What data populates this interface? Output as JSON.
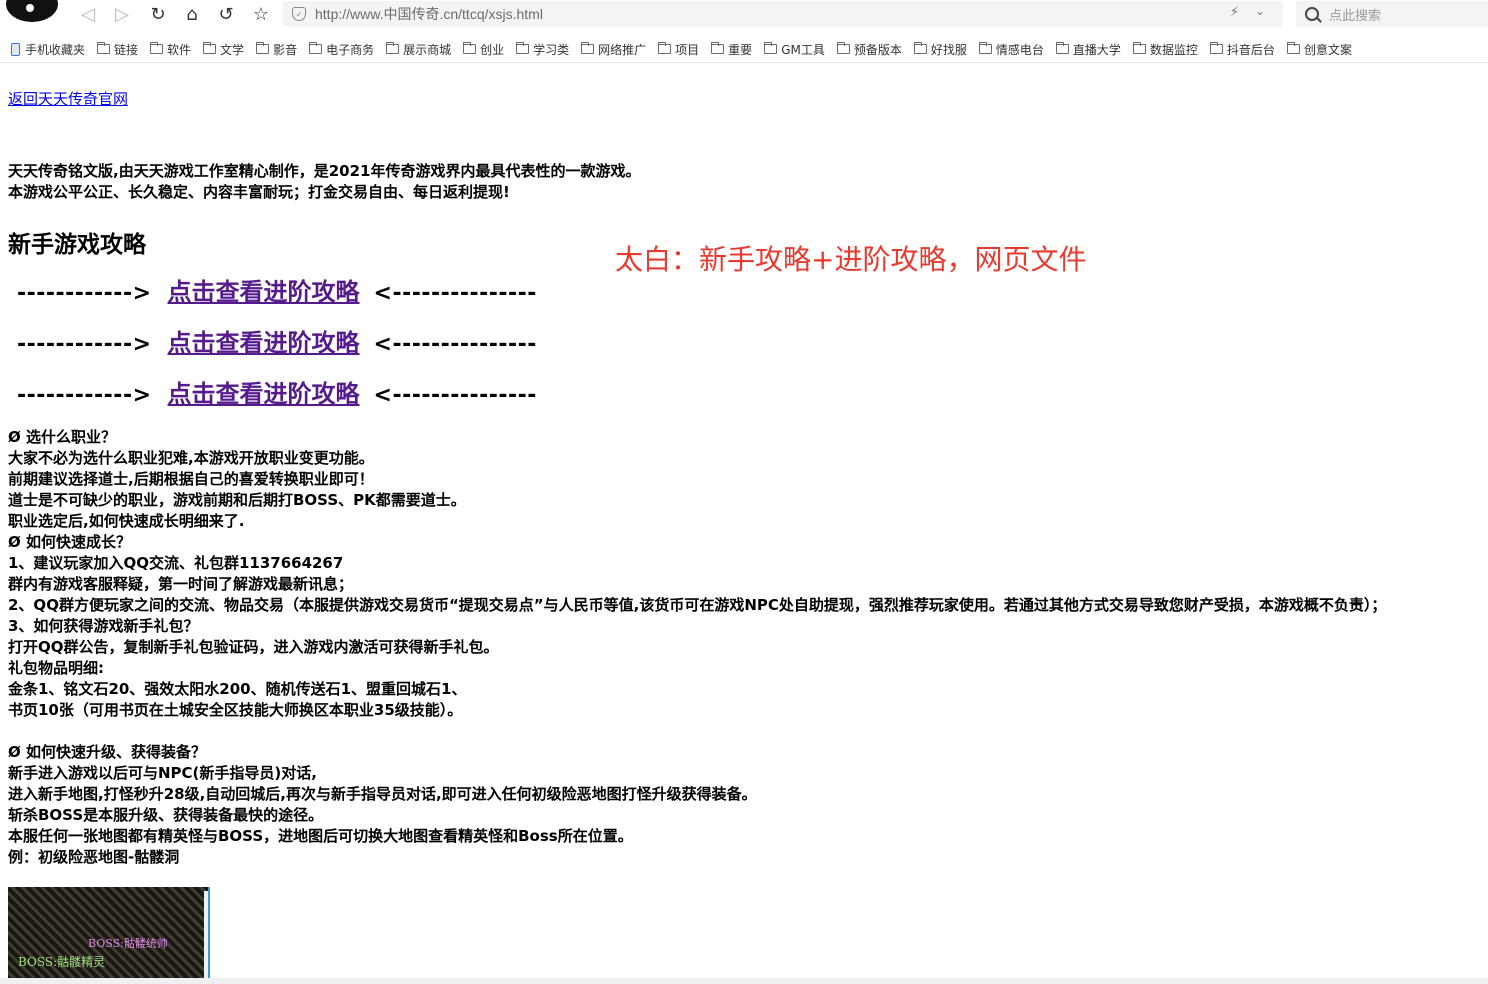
{
  "browser": {
    "url": "http://www.中国传奇.cn/ttcq/xsjs.html",
    "search_placeholder": "点此搜索",
    "icons": {
      "back": "◁",
      "forward": "▷",
      "reload": "↻",
      "home": "⌂",
      "undo": "↺",
      "star": "☆",
      "bolt": "⚡",
      "chevron": "⌄"
    }
  },
  "bookmarks": [
    {
      "label": "手机收藏夹",
      "icon": "phone"
    },
    {
      "label": "链接",
      "icon": "folder"
    },
    {
      "label": "软件",
      "icon": "folder"
    },
    {
      "label": "文学",
      "icon": "folder"
    },
    {
      "label": "影音",
      "icon": "folder"
    },
    {
      "label": "电子商务",
      "icon": "folder"
    },
    {
      "label": "展示商城",
      "icon": "folder"
    },
    {
      "label": "创业",
      "icon": "folder"
    },
    {
      "label": "学习类",
      "icon": "folder"
    },
    {
      "label": "网络推广",
      "icon": "folder"
    },
    {
      "label": "项目",
      "icon": "folder"
    },
    {
      "label": "重要",
      "icon": "folder"
    },
    {
      "label": "GM工具",
      "icon": "folder"
    },
    {
      "label": "预备版本",
      "icon": "folder"
    },
    {
      "label": "好找服",
      "icon": "folder"
    },
    {
      "label": "情感电台",
      "icon": "folder"
    },
    {
      "label": "直播大学",
      "icon": "folder"
    },
    {
      "label": "数据监控",
      "icon": "folder"
    },
    {
      "label": "抖音后台",
      "icon": "folder"
    },
    {
      "label": "创意文案",
      "icon": "folder"
    }
  ],
  "page": {
    "back_link": "返回天天传奇官网",
    "intro": [
      "天天传奇铭文版,由天天游戏工作室精心制作，是2021年传奇游戏界内最具代表性的一款游戏。",
      "本游戏公平公正、长久稳定、内容丰富耐玩；打金交易自由、每日返利提现!"
    ],
    "title": "新手游戏攻略",
    "annotation": "太白：新手攻略+进阶攻略，网页文件",
    "advanced_rows": [
      {
        "left": "------------>",
        "link": "点击查看进阶攻略",
        "right": "<---------------"
      },
      {
        "left": "------------>",
        "link": "点击查看进阶攻略",
        "right": "<---------------"
      },
      {
        "left": "------------>",
        "link": "点击查看进阶攻略",
        "right": "<---------------"
      }
    ],
    "guide_lines": [
      "Ø 选什么职业？",
      "大家不必为选什么职业犯难,本游戏开放职业变更功能。",
      "前期建议选择道士,后期根据自己的喜爱转换职业即可！",
      "道士是不可缺少的职业，游戏前期和后期打BOSS、PK都需要道士。",
      "职业选定后,如何快速成长明细来了.",
      "Ø 如何快速成长？",
      "1、建议玩家加入QQ交流、礼包群1137664267",
      "群内有游戏客服释疑，第一时间了解游戏最新讯息；",
      "2、QQ群方便玩家之间的交流、物品交易（本服提供游戏交易货币“提现交易点”与人民币等值,该货币可在游戏NPC处自助提现，强烈推荐玩家使用。若通过其他方式交易导致您财产受损，本游戏概不负责）；",
      "3、如何获得游戏新手礼包？",
      "打开QQ群公告，复制新手礼包验证码，进入游戏内激活可获得新手礼包。",
      "礼包物品明细:",
      "金条1、铭文石20、强效太阳水200、随机传送石1、盟重回城石1、",
      "书页10张（可用书页在土城安全区技能大师换区本职业35级技能）。",
      "",
      "Ø 如何快速升级、获得装备？",
      "新手进入游戏以后可与NPC(新手指导员)对话,",
      "进入新手地图,打怪秒升28级,自动回城后,再次与新手指导员对话,即可进入任何初级险恶地图打怪升级获得装备。",
      "斩杀BOSS是本服升级、获得装备最快的途径。",
      "本服任何一张地图都有精英怪与BOSS，进地图后可切换大地图查看精英怪和Boss所在位置。",
      "例：初级险恶地图-骷髅洞"
    ],
    "map_labels": {
      "boss1": "BOSS:骷髅统帅",
      "boss2": "BOSS:骷髅精灵"
    }
  },
  "colors": {
    "link": "#0000ee",
    "visited_link": "#551a8b",
    "annotation": "#e83a2e"
  }
}
